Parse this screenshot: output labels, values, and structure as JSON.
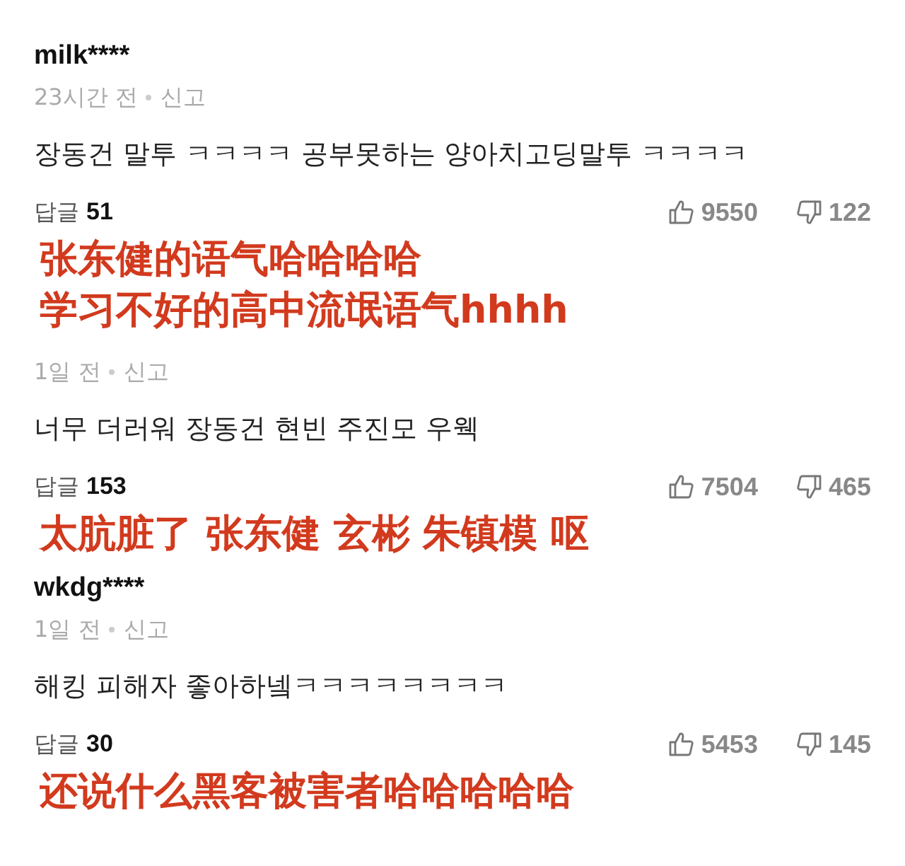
{
  "comments": [
    {
      "username": "milk****",
      "time": "23시간 전",
      "report": "신고",
      "text": "장동건 말투 ㅋㅋㅋㅋ 공부못하는 양아치고딩말투 ㅋㅋㅋㅋ",
      "reply_label": "답글",
      "reply_count": "51",
      "likes": "9550",
      "dislikes": "122",
      "caption": [
        "张东健的语气哈哈哈哈",
        "学习不好的高中流氓语气hhhh"
      ]
    },
    {
      "time": "1일 전",
      "report": "신고",
      "text": "너무 더러워 장동건 현빈 주진모 우웩",
      "reply_label": "답글",
      "reply_count": "153",
      "likes": "7504",
      "dislikes": "465",
      "caption": [
        "太肮脏了 张东健 玄彬 朱镇模 呕"
      ]
    },
    {
      "username": "wkdg****",
      "time": "1일 전",
      "report": "신고",
      "text": "해킹 피해자 좋아하넼ㅋㅋㅋㅋㅋㅋㅋㅋ",
      "reply_label": "답글",
      "reply_count": "30",
      "likes": "5453",
      "dislikes": "145",
      "caption": [
        "还说什么黑客被害者哈哈哈哈哈"
      ]
    }
  ]
}
